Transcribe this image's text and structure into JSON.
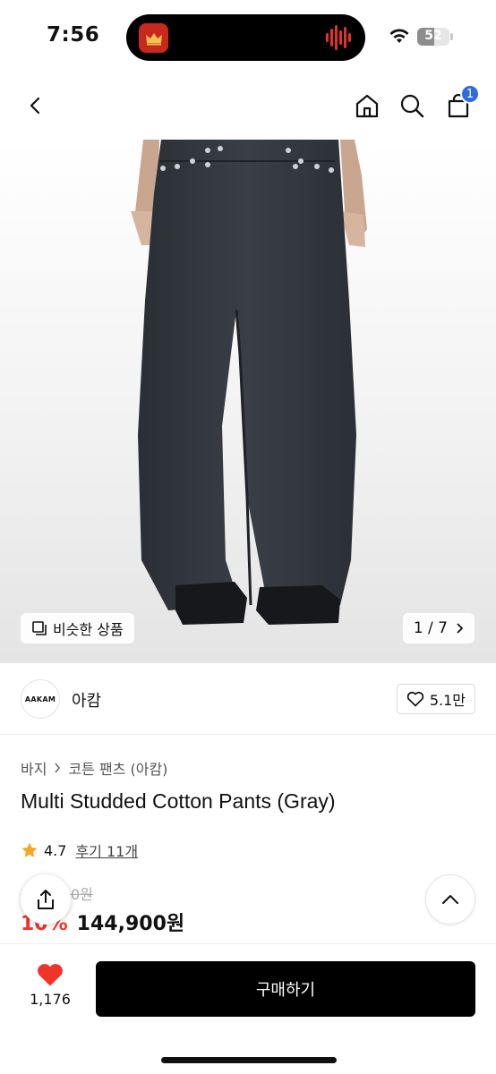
{
  "status_bar": {
    "time": "7:56",
    "battery": "52",
    "battery_level": 0.52
  },
  "nav": {
    "cart_count": "1"
  },
  "gallery": {
    "similar_label": "비슷한 상품",
    "pager": "1 / 7"
  },
  "brand": {
    "logo_text": "AAKAM",
    "name": "아캄",
    "likes": "5.1만"
  },
  "product": {
    "breadcrumb": [
      "바지",
      "코튼 팬츠 (아캄)"
    ],
    "title": "Multi Studded Cotton Pants (Gray)",
    "rating": "4.7",
    "review_label": "후기 11개",
    "original_price": "161,000원",
    "discount": "10%",
    "price": "144,900원"
  },
  "bottom_bar": {
    "like_count": "1,176",
    "buy_label": "구매하기"
  },
  "colors": {
    "accent_red": "#f0342b",
    "badge_blue": "#2e6ae0",
    "star": "#f5a623",
    "button_black": "#000000"
  }
}
